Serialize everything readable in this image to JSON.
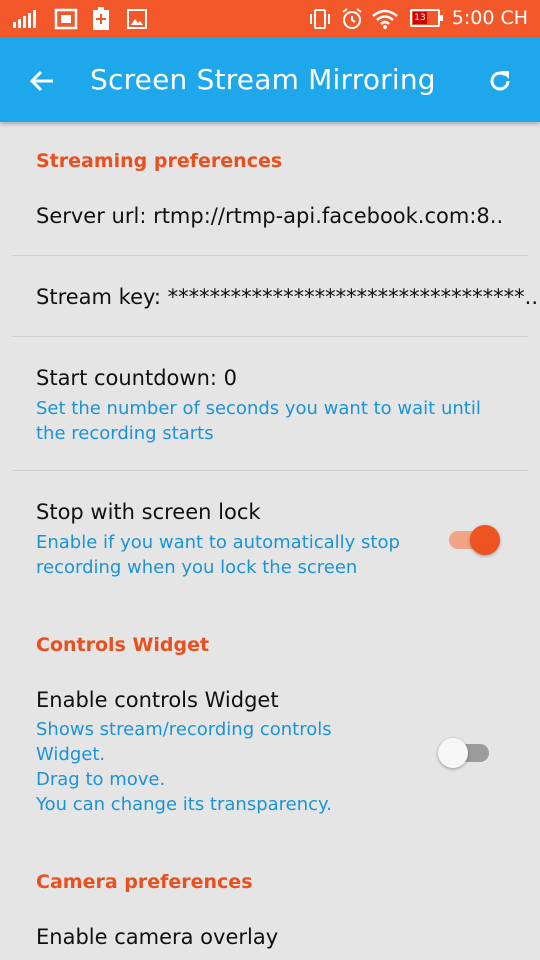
{
  "status_bar": {
    "time": "5:00 CH",
    "battery_level_text": "13",
    "icons": [
      "signal-icon",
      "sim-icon",
      "battery-plus-icon",
      "image-icon",
      "vibrate-icon",
      "alarm-icon",
      "wifi-icon",
      "battery-icon"
    ],
    "colors": {
      "background": "#f2582a"
    }
  },
  "app_bar": {
    "title": "Screen Stream Mirroring",
    "back_icon": "arrow-back-icon",
    "refresh_icon": "refresh-icon",
    "colors": {
      "background": "#1ea7ea"
    }
  },
  "sections": {
    "streaming": {
      "header": "Streaming preferences"
    },
    "controls": {
      "header": "Controls Widget"
    },
    "camera": {
      "header": "Camera preferences"
    }
  },
  "prefs": {
    "server_url": {
      "title": "Server url: rtmp://rtmp-api.facebook.com:8.."
    },
    "stream_key": {
      "title": "Stream key: **********************************.."
    },
    "start_countdown": {
      "title": "Start countdown: 0",
      "summary_line1": "Set the number of seconds you want to wait until",
      "summary_line2": "the recording starts"
    },
    "stop_with_lock": {
      "title": "Stop with screen lock",
      "summary_line1": "Enable if you want to automatically stop",
      "summary_line2": "recording when you lock the screen",
      "enabled": true
    },
    "controls_widget": {
      "title": "Enable controls Widget",
      "summary_line1": "Shows stream/recording controls",
      "summary_line2": "Widget.",
      "summary_line3": "Drag to move.",
      "summary_line4": "You can change its transparency.",
      "enabled": false
    },
    "camera_overlay": {
      "title": "Enable camera overlay"
    }
  },
  "colors": {
    "accent_orange": "#e8501f",
    "summary_blue": "#1a94d4",
    "background": "#e5e5e5"
  }
}
